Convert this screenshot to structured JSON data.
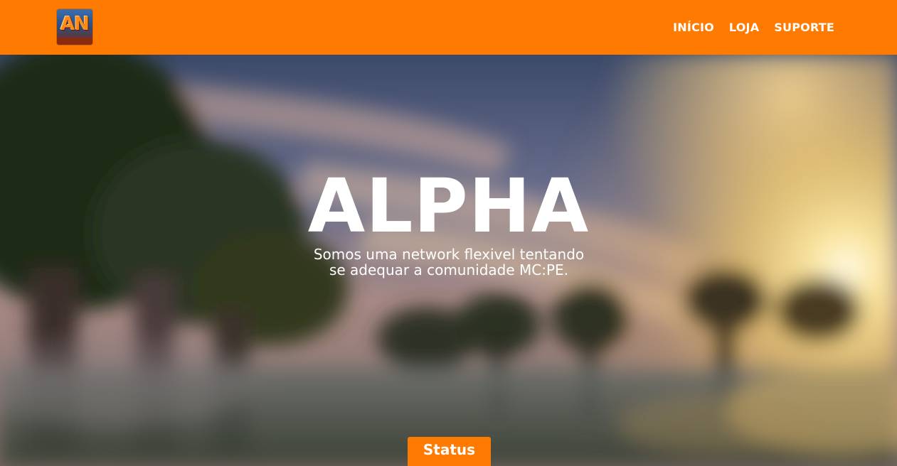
{
  "header": {
    "logo_icon": "alpha-network-logo",
    "logo_text": "AN",
    "brand_color": "#ff7a00",
    "nav": [
      {
        "label": "INÍCIO"
      },
      {
        "label": "LOJA"
      },
      {
        "label": "SUPORTE"
      }
    ]
  },
  "hero": {
    "title": "ALPHA",
    "tagline_line1": "Somos uma network flexivel tentando",
    "tagline_line2": "se adequar a comunidade MC:PE.",
    "status_button": "Status"
  }
}
